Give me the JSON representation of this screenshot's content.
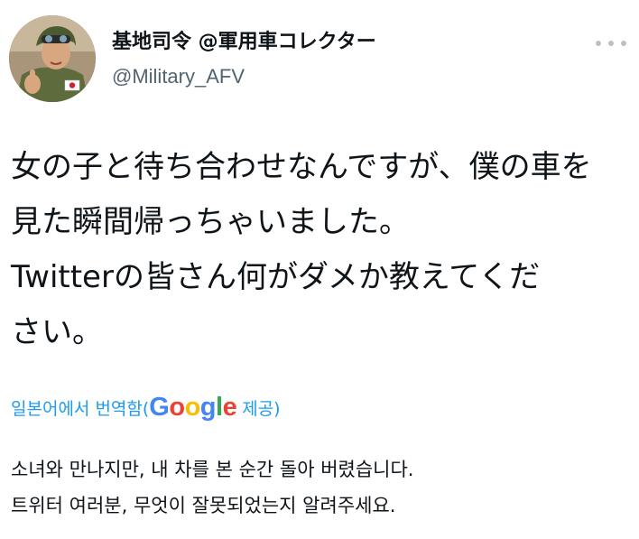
{
  "author": {
    "display_name": "基地司令 @軍用車コレクター",
    "handle": "@Military_AFV",
    "avatar_icon": "user-avatar-photo"
  },
  "more_icon": "more-options-icon",
  "tweet": {
    "lines": [
      "女の子と待ち合わせなんですが、僕の車を",
      "見た瞬間帰っちゃいました。",
      "Twitterの皆さん何がダメか教えてくだ",
      "さい。"
    ]
  },
  "translation": {
    "prefix": "일본어에서 번역함(",
    "provider": "Google",
    "suffix": " 제공)",
    "lines": [
      "소녀와 만나지만, 내 차를 본 순간 돌아 버렸습니다.",
      "트위터 여러분, 무엇이 잘못되었는지 알려주세요."
    ]
  },
  "colors": {
    "link": "#1d9bf0",
    "text": "#0f1419",
    "secondary": "#536471"
  }
}
